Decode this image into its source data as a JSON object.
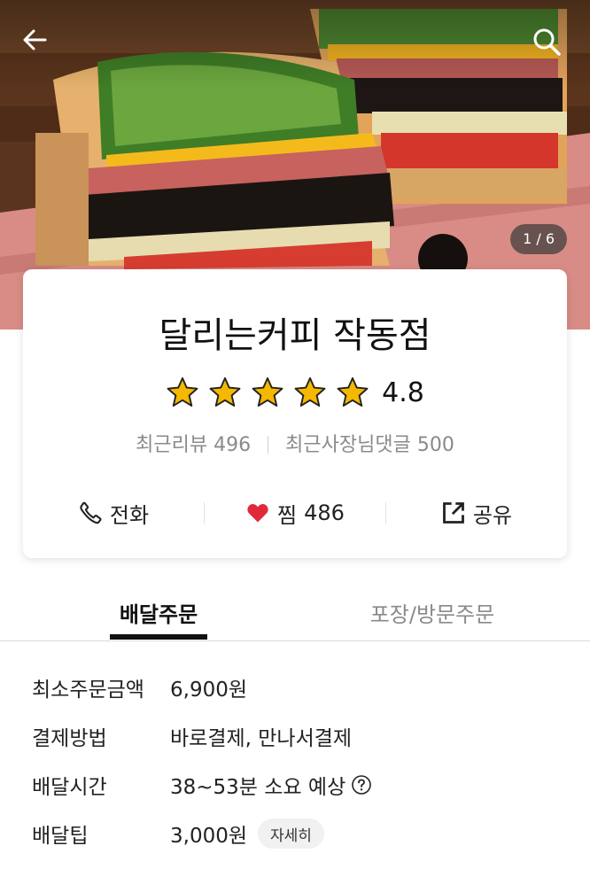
{
  "hero": {
    "photo_counter": "1 / 6",
    "back_icon": "arrow-left-icon",
    "search_icon": "search-icon"
  },
  "store": {
    "name": "달리는커피 작동점",
    "rating": "4.8",
    "stars": 5,
    "recent_reviews_label": "최근리뷰",
    "recent_reviews_count": "496",
    "owner_replies_label": "최근사장님댓글",
    "owner_replies_count": "500"
  },
  "actions": {
    "call_label": "전화",
    "like_label": "찜",
    "like_count": "486",
    "share_label": "공유"
  },
  "tabs": {
    "delivery": "배달주문",
    "pickup": "포장/방문주문"
  },
  "info": {
    "min_order_label": "최소주문금액",
    "min_order_value": "6,900원",
    "payment_label": "결제방법",
    "payment_value": "바로결제, 만나서결제",
    "delivery_time_label": "배달시간",
    "delivery_time_value": "38~53분 소요 예상",
    "delivery_tip_label": "배달팁",
    "delivery_tip_value": "3,000원",
    "detail_button": "자세히"
  },
  "colors": {
    "star": "#f5b800",
    "heart": "#e02a3c",
    "text": "#222222",
    "muted": "#8a8a8a"
  }
}
